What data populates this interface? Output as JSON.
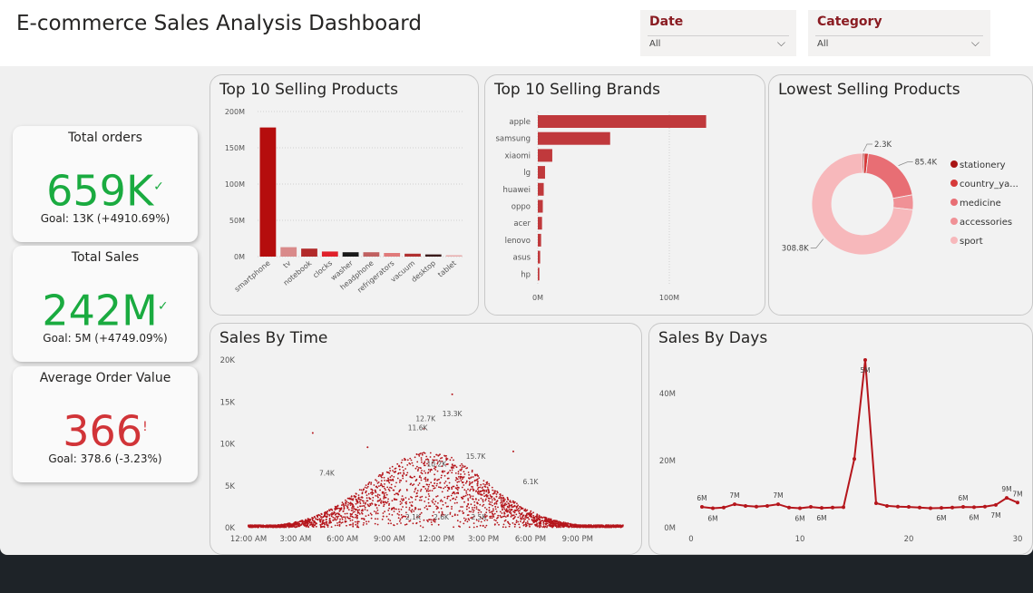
{
  "header": {
    "title": "E-commerce Sales Analysis Dashboard",
    "slicers": [
      {
        "label": "Date",
        "value": "All"
      },
      {
        "label": "Category",
        "value": "All"
      }
    ]
  },
  "colors": {
    "good": "#1aab40",
    "bad": "#d13438",
    "bar_main": "#b5161c",
    "bar_brand": "#c0393c"
  },
  "kpis": [
    {
      "title": "Total orders",
      "value": "659K",
      "goal": "Goal: 13K (+4910.69%)",
      "status": "good",
      "mark": "✓"
    },
    {
      "title": "Total Sales",
      "value": "242M",
      "goal": "Goal: 5M (+4749.09%)",
      "status": "good",
      "mark": "✓"
    },
    {
      "title": "Average Order Value",
      "value": "366",
      "goal": "Goal: 378.6 (-3.23%)",
      "status": "bad",
      "mark": "!"
    }
  ],
  "chart_data": [
    {
      "id": "top_products",
      "type": "bar",
      "title": "Top 10 Selling Products",
      "categories": [
        "smartphone",
        "tv",
        "notebook",
        "clocks",
        "washer",
        "headphone",
        "refrigerators",
        "vacuum",
        "desktop",
        "tablet"
      ],
      "values": [
        178,
        13,
        11,
        7,
        6,
        6,
        5,
        4,
        3,
        2
      ],
      "colors": [
        "#b50d0d",
        "#d98a8a",
        "#b22a2a",
        "#e0202a",
        "#1a1a1a",
        "#c06060",
        "#e07a7a",
        "#b03030",
        "#3a1a1a",
        "#e8b0b0"
      ],
      "yticks": [
        "0M",
        "50M",
        "100M",
        "150M",
        "200M"
      ],
      "ylim": [
        0,
        200
      ]
    },
    {
      "id": "top_brands",
      "type": "bar",
      "orientation": "horizontal",
      "title": "Top 10 Selling Brands",
      "categories": [
        "apple",
        "samsung",
        "xiaomi",
        "lg",
        "huawei",
        "oppo",
        "acer",
        "lenovo",
        "asus",
        "hp"
      ],
      "values": [
        128,
        55,
        11,
        5.5,
        4.5,
        3.8,
        3.2,
        2.5,
        1.8,
        1.2
      ],
      "xticks": [
        "0M",
        "100M"
      ],
      "xlim": [
        0,
        160
      ]
    },
    {
      "id": "lowest_products",
      "type": "pie",
      "title": "Lowest Selling Products",
      "labels": [
        "stationery",
        "country_ya...",
        "medicine",
        "accessories",
        "sport"
      ],
      "values": [
        2.3,
        5.5,
        85.4,
        20,
        308.8
      ],
      "colors": [
        "#a81515",
        "#d63a3a",
        "#e86e74",
        "#f09196",
        "#f7b8bb"
      ],
      "data_labels": [
        "2.3K",
        "85.4K",
        "308.8K"
      ]
    },
    {
      "id": "sales_by_time",
      "type": "scatter",
      "title": "Sales By Time",
      "x_ticks": [
        "12:00 AM",
        "3:00 AM",
        "6:00 AM",
        "9:00 AM",
        "12:00 PM",
        "3:00 PM",
        "6:00 PM",
        "9:00 PM"
      ],
      "y_ticks": [
        "0K",
        "5K",
        "10K",
        "15K",
        "20K"
      ],
      "ylim": [
        0,
        20
      ],
      "point_labels": [
        {
          "text": "13.3K",
          "x": 13,
          "y": 13.3
        },
        {
          "text": "12.7K",
          "x": 11.3,
          "y": 12.7
        },
        {
          "text": "11.6K",
          "x": 10.8,
          "y": 11.6
        },
        {
          "text": "15.7K",
          "x": 14.5,
          "y": 8.2
        },
        {
          "text": "10.2K",
          "x": 12,
          "y": 7.3
        },
        {
          "text": "6.1K",
          "x": 18,
          "y": 5.2
        },
        {
          "text": "7.4K",
          "x": 5,
          "y": 6.2
        },
        {
          "text": "2.1K",
          "x": 10.5,
          "y": 1.0
        },
        {
          "text": "2.6K",
          "x": 12.3,
          "y": 1.0
        },
        {
          "text": "2.5K",
          "x": 14.7,
          "y": 1.0
        }
      ]
    },
    {
      "id": "sales_by_days",
      "type": "line",
      "title": "Sales By Days",
      "x": [
        1,
        2,
        3,
        4,
        5,
        6,
        7,
        8,
        9,
        10,
        11,
        12,
        13,
        14,
        15,
        16,
        17,
        18,
        19,
        20,
        21,
        22,
        23,
        24,
        25,
        26,
        27,
        28,
        29,
        30
      ],
      "values": [
        6.2,
        5.8,
        6.0,
        7.0,
        6.5,
        6.3,
        6.5,
        7.0,
        6.0,
        5.8,
        6.2,
        5.9,
        6.0,
        6.1,
        20.5,
        50.0,
        7.3,
        6.5,
        6.3,
        6.2,
        6.0,
        5.8,
        5.9,
        6.0,
        6.2,
        6.1,
        6.3,
        6.8,
        8.9,
        7.5
      ],
      "x_ticks": [
        "0",
        "10",
        "20",
        "30"
      ],
      "y_ticks": [
        "0M",
        "20M",
        "40M"
      ],
      "ylim": [
        0,
        50
      ],
      "point_labels": [
        {
          "text": "6M",
          "x": 1,
          "y": 6.2,
          "pos": "above"
        },
        {
          "text": "6M",
          "x": 2,
          "y": 5.8,
          "pos": "below"
        },
        {
          "text": "7M",
          "x": 4,
          "y": 7.0,
          "pos": "above"
        },
        {
          "text": "7M",
          "x": 8,
          "y": 7.0,
          "pos": "above"
        },
        {
          "text": "6M",
          "x": 10,
          "y": 5.8,
          "pos": "below"
        },
        {
          "text": "6M",
          "x": 12,
          "y": 5.9,
          "pos": "below"
        },
        {
          "text": "5M",
          "x": 16,
          "y": 50.0,
          "pos": "below"
        },
        {
          "text": "6M",
          "x": 25,
          "y": 6.2,
          "pos": "above"
        },
        {
          "text": "6M",
          "x": 23,
          "y": 5.9,
          "pos": "below"
        },
        {
          "text": "6M",
          "x": 26,
          "y": 6.1,
          "pos": "below"
        },
        {
          "text": "7M",
          "x": 28,
          "y": 6.8,
          "pos": "below"
        },
        {
          "text": "9M",
          "x": 29,
          "y": 8.9,
          "pos": "above"
        },
        {
          "text": "7M",
          "x": 30,
          "y": 7.5,
          "pos": "above"
        }
      ]
    }
  ]
}
